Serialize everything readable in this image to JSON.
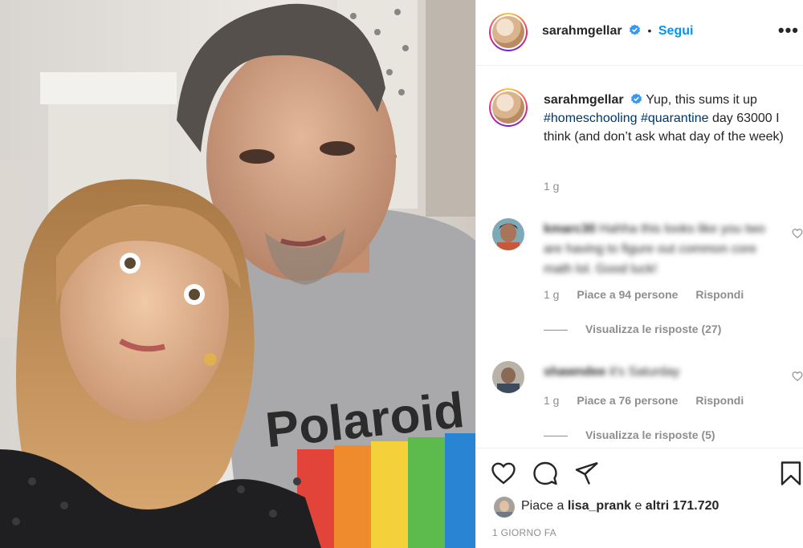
{
  "post": {
    "author": "sarahmgellar",
    "follow_label": "Segui",
    "dot": "•",
    "more": "•••",
    "caption_prefix": "Yup, this sums it up",
    "hashtags": [
      "#homeschooling",
      "#quarantine"
    ],
    "caption_suffix": "day 63000 I think (and don’t ask what day of the week)",
    "caption_time": "1 g",
    "photo_text": "Polaroid"
  },
  "comments": [
    {
      "username": "kmarc30",
      "text": "Hahha this looks like you two are having to figure out common core math lol. Good luck!",
      "time": "1 g",
      "likes": "Piace a 94 persone",
      "reply": "Rispondi",
      "view_replies": "Visualizza le risposte (27)"
    },
    {
      "username": "shawndee",
      "text": "it's Saturday",
      "time": "1 g",
      "likes": "Piace a 76 persone",
      "reply": "Rispondi",
      "view_replies": "Visualizza le risposte (5)"
    }
  ],
  "footer": {
    "likes_prefix": "Piace a",
    "liked_by": "lisa_prank",
    "likes_mid": "e",
    "likes_count": "altri 171.720",
    "time_ago": "1 GIORNO FA"
  },
  "colors": {
    "accent": "#0095f6",
    "hashtag": "#00376b",
    "secondary_text": "#8e8e8e",
    "border": "#efefef"
  },
  "icons": [
    "heart-icon",
    "comment-icon",
    "share-icon",
    "bookmark-icon",
    "verified-badge-icon",
    "more-options-icon"
  ]
}
